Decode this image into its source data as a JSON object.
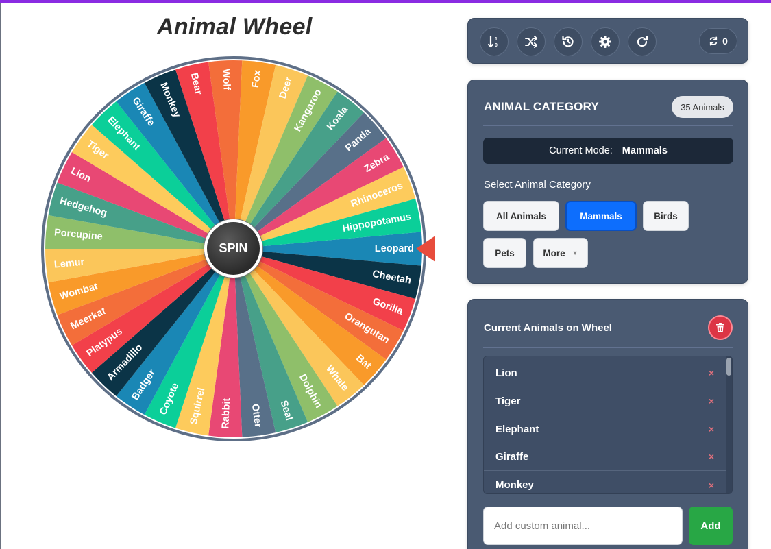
{
  "app": {
    "title": "Animal Wheel",
    "accent_color": "#8a2be2"
  },
  "wheel": {
    "spin_label": "SPIN",
    "pointer_color": "#e74c3c",
    "segments": [
      {
        "label": "Leopard",
        "color": "#1a87b5"
      },
      {
        "label": "Cheetah",
        "color": "#0b3447"
      },
      {
        "label": "Gorilla",
        "color": "#f2404a"
      },
      {
        "label": "Orangutan",
        "color": "#f36e3a"
      },
      {
        "label": "Bat",
        "color": "#f99a2a"
      },
      {
        "label": "Whale",
        "color": "#fbc65a"
      },
      {
        "label": "Dolphin",
        "color": "#8fbf6a"
      },
      {
        "label": "Seal",
        "color": "#47a089"
      },
      {
        "label": "Otter",
        "color": "#587089"
      },
      {
        "label": "Rabbit",
        "color": "#e84874"
      },
      {
        "label": "Squirrel",
        "color": "#fdcb5c"
      },
      {
        "label": "Coyote",
        "color": "#0bcf99"
      },
      {
        "label": "Badger",
        "color": "#1a87b5"
      },
      {
        "label": "Armadillo",
        "color": "#0b3447"
      },
      {
        "label": "Platypus",
        "color": "#f2404a"
      },
      {
        "label": "Meerkat",
        "color": "#f36e3a"
      },
      {
        "label": "Wombat",
        "color": "#f99a2a"
      },
      {
        "label": "Lemur",
        "color": "#fbc65a"
      },
      {
        "label": "Porcupine",
        "color": "#8fbf6a"
      },
      {
        "label": "Hedgehog",
        "color": "#47a089"
      },
      {
        "label": "Lion",
        "color": "#e84874"
      },
      {
        "label": "Tiger",
        "color": "#fdcb5c"
      },
      {
        "label": "Elephant",
        "color": "#0bcf99"
      },
      {
        "label": "Giraffe",
        "color": "#1a87b5"
      },
      {
        "label": "Monkey",
        "color": "#0b3447"
      },
      {
        "label": "Bear",
        "color": "#f2404a"
      },
      {
        "label": "Wolf",
        "color": "#f36e3a"
      },
      {
        "label": "Fox",
        "color": "#f99a2a"
      },
      {
        "label": "Deer",
        "color": "#fbc65a"
      },
      {
        "label": "Kangaroo",
        "color": "#8fbf6a"
      },
      {
        "label": "Koala",
        "color": "#47a089"
      },
      {
        "label": "Panda",
        "color": "#587089"
      },
      {
        "label": "Zebra",
        "color": "#e84874"
      },
      {
        "label": "Rhinoceros",
        "color": "#fdcb5c"
      },
      {
        "label": "Hippopotamus",
        "color": "#0bcf99"
      }
    ]
  },
  "toolbar": {
    "buttons": [
      {
        "icon": "sort-icon"
      },
      {
        "icon": "shuffle-icon"
      },
      {
        "icon": "history-icon"
      },
      {
        "icon": "gear-icon"
      },
      {
        "icon": "redo-icon"
      }
    ],
    "spin_count": "0"
  },
  "category": {
    "heading": "ANIMAL CATEGORY",
    "count_badge": "35 Animals",
    "mode_label": "Current Mode:",
    "mode_value": "Mammals",
    "select_label": "Select Animal Category",
    "buttons": [
      {
        "label": "All Animals",
        "active": false
      },
      {
        "label": "Mammals",
        "active": true
      },
      {
        "label": "Birds",
        "active": false
      },
      {
        "label": "Pets",
        "active": false
      },
      {
        "label": "More",
        "active": false
      }
    ],
    "active_color": "#0d6efd"
  },
  "animal_list": {
    "heading": "Current Animals on Wheel",
    "items": [
      "Lion",
      "Tiger",
      "Elephant",
      "Giraffe",
      "Monkey"
    ],
    "remove_glyph": "×",
    "input_placeholder": "Add custom animal...",
    "add_label": "Add",
    "add_color": "#28a745",
    "clear_color": "#dc3545"
  }
}
